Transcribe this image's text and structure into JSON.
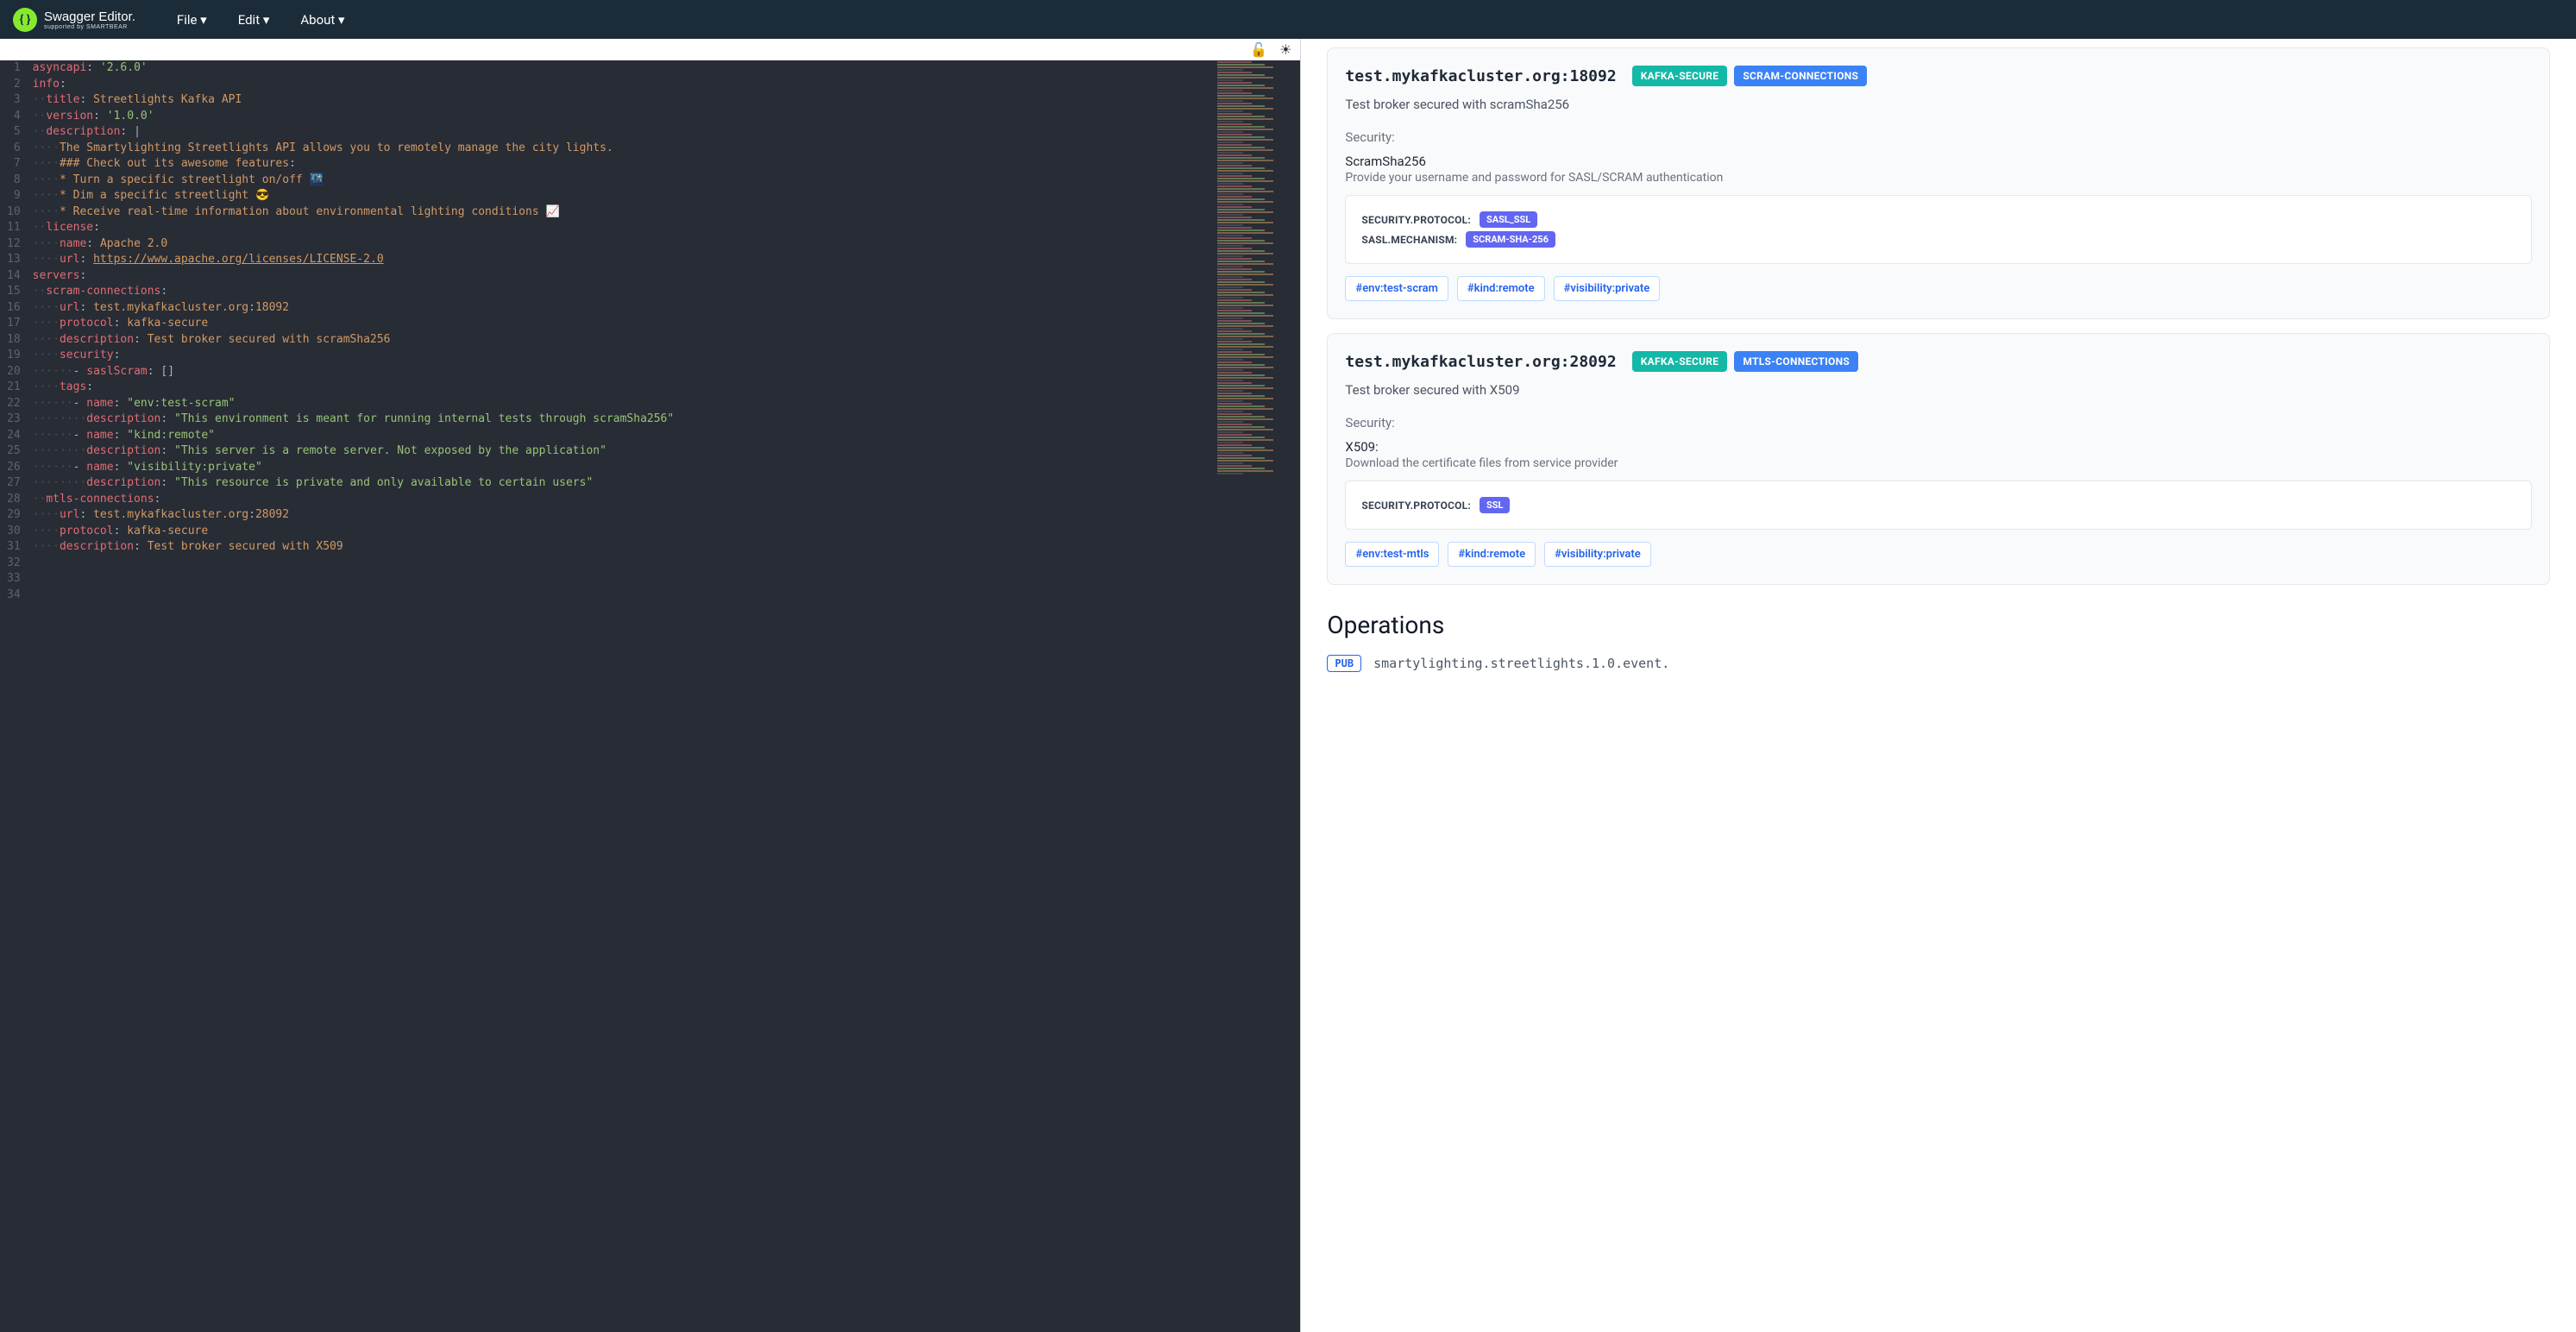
{
  "header": {
    "brand_main": "Swagger Editor.",
    "brand_sub": "supported by SMARTBEAR",
    "menus": {
      "file": "File ▾",
      "edit": "Edit ▾",
      "about": "About ▾"
    }
  },
  "editor": {
    "icons": {
      "lock": "🔓",
      "theme": "☀"
    },
    "code_lines": [
      [
        {
          "t": "key",
          "v": "asyncapi"
        },
        {
          "t": "punc",
          "v": ": "
        },
        {
          "t": "str",
          "v": "'2.6.0'"
        }
      ],
      [
        {
          "t": "key",
          "v": "info"
        },
        {
          "t": "punc",
          "v": ":"
        }
      ],
      [
        {
          "t": "indent",
          "v": "··"
        },
        {
          "t": "key",
          "v": "title"
        },
        {
          "t": "punc",
          "v": ": "
        },
        {
          "t": "plain",
          "v": "Streetlights Kafka API"
        }
      ],
      [
        {
          "t": "indent",
          "v": "··"
        },
        {
          "t": "key",
          "v": "version"
        },
        {
          "t": "punc",
          "v": ": "
        },
        {
          "t": "str",
          "v": "'1.0.0'"
        }
      ],
      [
        {
          "t": "indent",
          "v": "··"
        },
        {
          "t": "key",
          "v": "description"
        },
        {
          "t": "punc",
          "v": ": "
        },
        {
          "t": "punc",
          "v": "|"
        }
      ],
      [
        {
          "t": "indent",
          "v": "····"
        },
        {
          "t": "plain",
          "v": "The Smartylighting Streetlights API allows you to remotely manage the city lights."
        }
      ],
      [
        {
          "t": "indent",
          "v": ""
        }
      ],
      [
        {
          "t": "indent",
          "v": "····"
        },
        {
          "t": "plain",
          "v": "### Check out its awesome features"
        },
        {
          "t": "punc",
          "v": ":"
        }
      ],
      [
        {
          "t": "indent",
          "v": ""
        }
      ],
      [
        {
          "t": "indent",
          "v": "····"
        },
        {
          "t": "plain",
          "v": "* Turn a specific streetlight on/off 🌃"
        }
      ],
      [
        {
          "t": "indent",
          "v": "····"
        },
        {
          "t": "plain",
          "v": "* Dim a specific streetlight 😎"
        }
      ],
      [
        {
          "t": "indent",
          "v": "····"
        },
        {
          "t": "plain",
          "v": "* Receive real-time information about environmental lighting conditions 📈"
        }
      ],
      [
        {
          "t": "indent",
          "v": "··"
        },
        {
          "t": "key",
          "v": "license"
        },
        {
          "t": "punc",
          "v": ":"
        }
      ],
      [
        {
          "t": "indent",
          "v": "····"
        },
        {
          "t": "key",
          "v": "name"
        },
        {
          "t": "punc",
          "v": ": "
        },
        {
          "t": "plain",
          "v": "Apache 2.0"
        }
      ],
      [
        {
          "t": "indent",
          "v": "····"
        },
        {
          "t": "key",
          "v": "url"
        },
        {
          "t": "punc",
          "v": ": "
        },
        {
          "t": "url",
          "v": "https://www.apache.org/licenses/LICENSE-2.0"
        }
      ],
      [
        {
          "t": "indent",
          "v": ""
        }
      ],
      [
        {
          "t": "key",
          "v": "servers"
        },
        {
          "t": "punc",
          "v": ":"
        }
      ],
      [
        {
          "t": "indent",
          "v": "··"
        },
        {
          "t": "key",
          "v": "scram-connections"
        },
        {
          "t": "punc",
          "v": ":"
        }
      ],
      [
        {
          "t": "indent",
          "v": "····"
        },
        {
          "t": "key",
          "v": "url"
        },
        {
          "t": "punc",
          "v": ": "
        },
        {
          "t": "plain",
          "v": "test.mykafkacluster.org"
        },
        {
          "t": "punc",
          "v": ":"
        },
        {
          "t": "num",
          "v": "18092"
        }
      ],
      [
        {
          "t": "indent",
          "v": "····"
        },
        {
          "t": "key",
          "v": "protocol"
        },
        {
          "t": "punc",
          "v": ": "
        },
        {
          "t": "plain",
          "v": "kafka-secure"
        }
      ],
      [
        {
          "t": "indent",
          "v": "····"
        },
        {
          "t": "key",
          "v": "description"
        },
        {
          "t": "punc",
          "v": ": "
        },
        {
          "t": "plain",
          "v": "Test broker secured with scramSha256"
        }
      ],
      [
        {
          "t": "indent",
          "v": "····"
        },
        {
          "t": "key",
          "v": "security"
        },
        {
          "t": "punc",
          "v": ":"
        }
      ],
      [
        {
          "t": "indent",
          "v": "······"
        },
        {
          "t": "dash",
          "v": "- "
        },
        {
          "t": "key",
          "v": "saslScram"
        },
        {
          "t": "punc",
          "v": ": "
        },
        {
          "t": "punc",
          "v": "[]"
        }
      ],
      [
        {
          "t": "indent",
          "v": "····"
        },
        {
          "t": "key",
          "v": "tags"
        },
        {
          "t": "punc",
          "v": ":"
        }
      ],
      [
        {
          "t": "indent",
          "v": "······"
        },
        {
          "t": "dash",
          "v": "- "
        },
        {
          "t": "key",
          "v": "name"
        },
        {
          "t": "punc",
          "v": ": "
        },
        {
          "t": "str",
          "v": "\"env:test-scram\""
        }
      ],
      [
        {
          "t": "indent",
          "v": "········"
        },
        {
          "t": "key",
          "v": "description"
        },
        {
          "t": "punc",
          "v": ": "
        },
        {
          "t": "str",
          "v": "\"This environment is meant for running internal tests through scramSha256\""
        }
      ],
      [
        {
          "t": "indent",
          "v": "······"
        },
        {
          "t": "dash",
          "v": "- "
        },
        {
          "t": "key",
          "v": "name"
        },
        {
          "t": "punc",
          "v": ": "
        },
        {
          "t": "str",
          "v": "\"kind:remote\""
        }
      ],
      [
        {
          "t": "indent",
          "v": "········"
        },
        {
          "t": "key",
          "v": "description"
        },
        {
          "t": "punc",
          "v": ": "
        },
        {
          "t": "str",
          "v": "\"This server is a remote server. Not exposed by the application\""
        }
      ],
      [
        {
          "t": "indent",
          "v": "······"
        },
        {
          "t": "dash",
          "v": "- "
        },
        {
          "t": "key",
          "v": "name"
        },
        {
          "t": "punc",
          "v": ": "
        },
        {
          "t": "str",
          "v": "\"visibility:private\""
        }
      ],
      [
        {
          "t": "indent",
          "v": "········"
        },
        {
          "t": "key",
          "v": "description"
        },
        {
          "t": "punc",
          "v": ": "
        },
        {
          "t": "str",
          "v": "\"This resource is private and only available to certain users\""
        }
      ],
      [
        {
          "t": "indent",
          "v": "··"
        },
        {
          "t": "key",
          "v": "mtls-connections"
        },
        {
          "t": "punc",
          "v": ":"
        }
      ],
      [
        {
          "t": "indent",
          "v": "····"
        },
        {
          "t": "key",
          "v": "url"
        },
        {
          "t": "punc",
          "v": ": "
        },
        {
          "t": "plain",
          "v": "test.mykafkacluster.org"
        },
        {
          "t": "punc",
          "v": ":"
        },
        {
          "t": "num",
          "v": "28092"
        }
      ],
      [
        {
          "t": "indent",
          "v": "····"
        },
        {
          "t": "key",
          "v": "protocol"
        },
        {
          "t": "punc",
          "v": ": "
        },
        {
          "t": "plain",
          "v": "kafka-secure"
        }
      ],
      [
        {
          "t": "indent",
          "v": "····"
        },
        {
          "t": "key",
          "v": "description"
        },
        {
          "t": "punc",
          "v": ": "
        },
        {
          "t": "plain",
          "v": "Test broker secured with X509"
        }
      ]
    ]
  },
  "preview": {
    "servers": [
      {
        "url": "test.mykafkacluster.org:18092",
        "badges": [
          {
            "text": "KAFKA-SECURE",
            "cls": "badge-teal"
          },
          {
            "text": "SCRAM-CONNECTIONS",
            "cls": "badge-blue"
          }
        ],
        "desc": "Test broker secured with scramSha256",
        "sec_label": "Security:",
        "sec_name": "ScramSha256",
        "sec_help": "Provide your username and password for SASL/SCRAM authentication",
        "kv": [
          {
            "k": "SECURITY.PROTOCOL:",
            "v": "SASL_SSL"
          },
          {
            "k": "SASL.MECHANISM:",
            "v": "SCRAM-SHA-256"
          }
        ],
        "tags": [
          "#env:test-scram",
          "#kind:remote",
          "#visibility:private"
        ]
      },
      {
        "url": "test.mykafkacluster.org:28092",
        "badges": [
          {
            "text": "KAFKA-SECURE",
            "cls": "badge-teal"
          },
          {
            "text": "MTLS-CONNECTIONS",
            "cls": "badge-blue"
          }
        ],
        "desc": "Test broker secured with X509",
        "sec_label": "Security:",
        "sec_name": "X509:",
        "sec_help": "Download the certificate files from service provider",
        "kv": [
          {
            "k": "SECURITY.PROTOCOL:",
            "v": "SSL"
          }
        ],
        "tags": [
          "#env:test-mtls",
          "#kind:remote",
          "#visibility:private"
        ]
      }
    ],
    "operations_heading": "Operations",
    "op": {
      "verb": "PUB",
      "path": "smartylighting.streetlights.1.0.event."
    }
  }
}
